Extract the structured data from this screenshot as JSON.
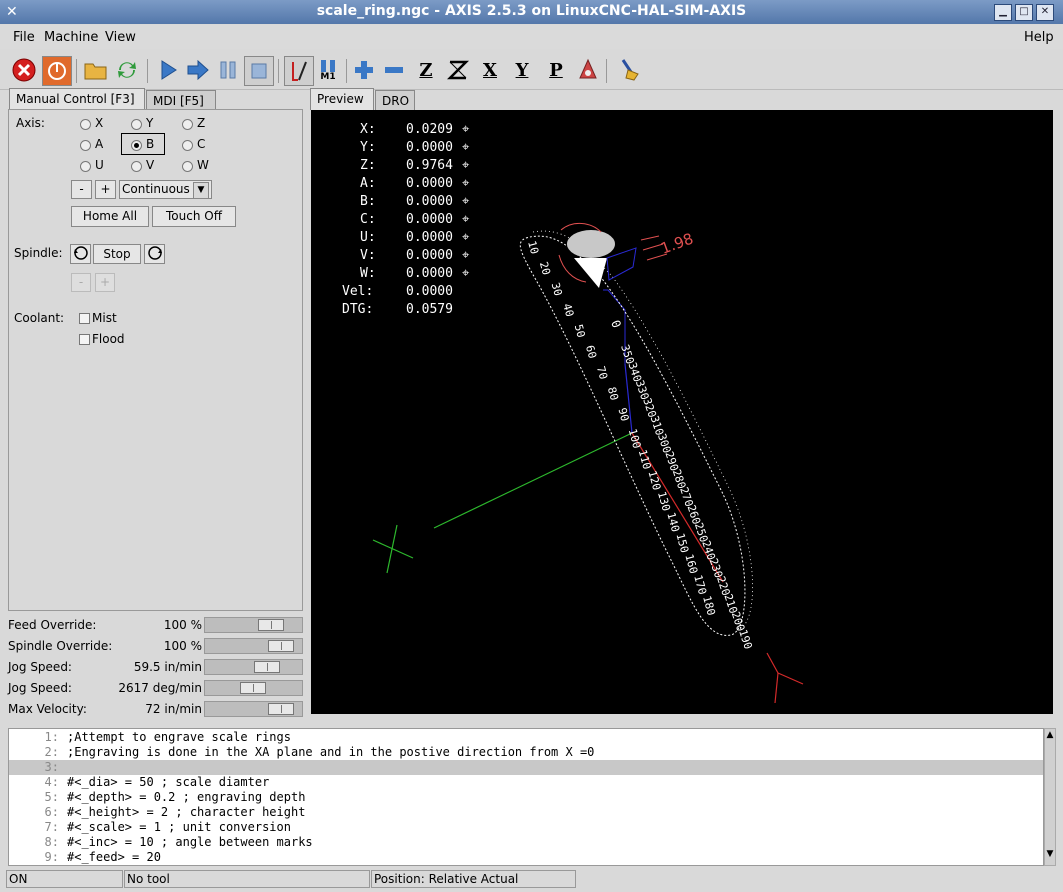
{
  "window": {
    "title": "scale_ring.ngc - AXIS 2.5.3 on LinuxCNC-HAL-SIM-AXIS"
  },
  "menu": {
    "file": "File",
    "machine": "Machine",
    "view": "View",
    "help": "Help"
  },
  "toolbar": {
    "z": "Z",
    "x": "X",
    "y": "Y",
    "p": "P",
    "m1": "M1"
  },
  "left_tabs": {
    "manual": "Manual Control [F3]",
    "mdi": "MDI [F5]"
  },
  "manual": {
    "axis_label": "Axis:",
    "axes": [
      "X",
      "Y",
      "Z",
      "A",
      "B",
      "C",
      "U",
      "V",
      "W"
    ],
    "selected_axis": "B",
    "minus": "-",
    "plus": "+",
    "jog_mode": "Continuous",
    "home_all": "Home All",
    "touch_off": "Touch Off",
    "spindle_label": "Spindle:",
    "stop": "Stop",
    "coolant_label": "Coolant:",
    "mist": "Mist",
    "flood": "Flood"
  },
  "overrides": [
    {
      "label": "Feed Override:",
      "value": "100 %",
      "fill": 0.75
    },
    {
      "label": "Spindle Override:",
      "value": "100 %",
      "fill": 0.9
    },
    {
      "label": "Jog Speed:",
      "value": "59.5 in/min",
      "fill": 0.7
    },
    {
      "label": "Jog Speed:",
      "value": "2617 deg/min",
      "fill": 0.5
    },
    {
      "label": "Max Velocity:",
      "value": "72 in/min",
      "fill": 0.9
    }
  ],
  "right_tabs": {
    "preview": "Preview",
    "dro": "DRO"
  },
  "dro": [
    {
      "label": "X:",
      "value": "0.0209"
    },
    {
      "label": "Y:",
      "value": "0.0000"
    },
    {
      "label": "Z:",
      "value": "0.9764"
    },
    {
      "label": "A:",
      "value": "0.0000"
    },
    {
      "label": "B:",
      "value": "0.0000"
    },
    {
      "label": "C:",
      "value": "0.0000"
    },
    {
      "label": "U:",
      "value": "0.0000"
    },
    {
      "label": "V:",
      "value": "0.0000"
    },
    {
      "label": "W:",
      "value": "0.0000"
    },
    {
      "label": "Vel:",
      "value": "0.0000"
    },
    {
      "label": "DTG:",
      "value": "0.0579"
    }
  ],
  "code": [
    {
      "n": "1:",
      "text": ";Attempt to engrave scale rings"
    },
    {
      "n": "2:",
      "text": ";Engraving is done in the XA plane and in the postive direction from X =0"
    },
    {
      "n": "3:",
      "text": ""
    },
    {
      "n": "4:",
      "text": "#<_dia> = 50 ; scale diamter"
    },
    {
      "n": "5:",
      "text": "#<_depth> = 0.2 ; engraving depth"
    },
    {
      "n": "6:",
      "text": "#<_height> = 2 ; character height"
    },
    {
      "n": "7:",
      "text": "#<_scale> = 1 ; unit conversion"
    },
    {
      "n": "8:",
      "text": "#<_inc> = 10 ; angle between marks"
    },
    {
      "n": "9:",
      "text": "#<_feed> = 20"
    }
  ],
  "status": {
    "state": "ON",
    "tool": "No tool",
    "position": "Position: Relative Actual"
  },
  "preview_labels": {
    "top": "0",
    "left": [
      "10",
      "20",
      "30",
      "40",
      "50",
      "60",
      "70",
      "80",
      "90",
      "100",
      "110",
      "120",
      "130",
      "140",
      "150",
      "160",
      "170",
      "180"
    ],
    "right": [
      "350",
      "340",
      "330",
      "320",
      "310",
      "300",
      "290",
      "280",
      "270",
      "260",
      "250",
      "240",
      "230",
      "220",
      "210",
      "200",
      "190"
    ],
    "dim": "1.98"
  }
}
